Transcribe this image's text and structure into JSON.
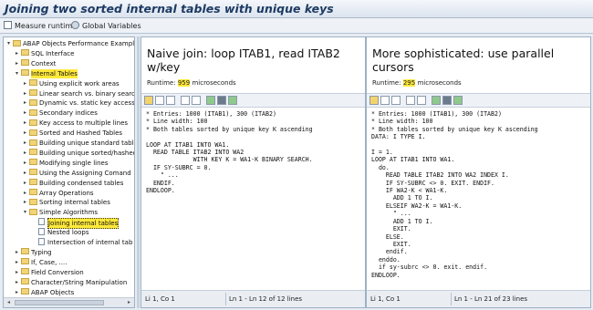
{
  "title": "Joining two sorted internal tables with unique keys",
  "toolbar": {
    "measure_label": "Measure runtime",
    "globals_label": "Global Variables"
  },
  "tree": {
    "items": [
      {
        "label": "ABAP Objects Performance Examples",
        "indent": 0,
        "type": "folder",
        "exp": "▾",
        "highlight": false
      },
      {
        "label": "SQL Interface",
        "indent": 1,
        "type": "folder",
        "exp": "▸",
        "highlight": false
      },
      {
        "label": "Context",
        "indent": 1,
        "type": "folder",
        "exp": "▸",
        "highlight": false
      },
      {
        "label": "Internal Tables",
        "indent": 1,
        "type": "folder",
        "exp": "▾",
        "highlight": true
      },
      {
        "label": "Using explicit work areas",
        "indent": 2,
        "type": "folder",
        "exp": "▸",
        "highlight": false
      },
      {
        "label": "Linear search vs. binary search",
        "indent": 2,
        "type": "folder",
        "exp": "▸",
        "highlight": false
      },
      {
        "label": "Dynamic vs. static key access",
        "indent": 2,
        "type": "folder",
        "exp": "▸",
        "highlight": false
      },
      {
        "label": "Secondary indices",
        "indent": 2,
        "type": "folder",
        "exp": "▸",
        "highlight": false
      },
      {
        "label": "Key access to multiple lines",
        "indent": 2,
        "type": "folder",
        "exp": "▸",
        "highlight": false
      },
      {
        "label": "Sorted and Hashed Tables",
        "indent": 2,
        "type": "folder",
        "exp": "▸",
        "highlight": false
      },
      {
        "label": "Building unique standard table",
        "indent": 2,
        "type": "folder",
        "exp": "▸",
        "highlight": false
      },
      {
        "label": "Building unique sorted/hashed",
        "indent": 2,
        "type": "folder",
        "exp": "▸",
        "highlight": false
      },
      {
        "label": "Modifying single lines",
        "indent": 2,
        "type": "folder",
        "exp": "▸",
        "highlight": false
      },
      {
        "label": "Using the Assigning Comand",
        "indent": 2,
        "type": "folder",
        "exp": "▸",
        "highlight": false
      },
      {
        "label": "Building condensed tables",
        "indent": 2,
        "type": "folder",
        "exp": "▸",
        "highlight": false
      },
      {
        "label": "Array Operations",
        "indent": 2,
        "type": "folder",
        "exp": "▸",
        "highlight": false
      },
      {
        "label": "Sorting internal tables",
        "indent": 2,
        "type": "folder",
        "exp": "▸",
        "highlight": false
      },
      {
        "label": "Simple Algorithms",
        "indent": 2,
        "type": "folder",
        "exp": "▾",
        "highlight": false
      },
      {
        "label": "Joining internal tables",
        "indent": 3,
        "type": "doc",
        "exp": "",
        "highlight": true
      },
      {
        "label": "Nested loops",
        "indent": 3,
        "type": "doc",
        "exp": "",
        "highlight": false
      },
      {
        "label": "Intersection of internal tab",
        "indent": 3,
        "type": "doc",
        "exp": "",
        "highlight": false
      },
      {
        "label": "Typing",
        "indent": 1,
        "type": "folder",
        "exp": "▸",
        "highlight": false
      },
      {
        "label": "If, Case, ....",
        "indent": 1,
        "type": "folder",
        "exp": "▸",
        "highlight": false
      },
      {
        "label": "Field Conversion",
        "indent": 1,
        "type": "folder",
        "exp": "▸",
        "highlight": false
      },
      {
        "label": "Character/String Manipulation",
        "indent": 1,
        "type": "folder",
        "exp": "▸",
        "highlight": false
      },
      {
        "label": "ABAP Objects",
        "indent": 1,
        "type": "folder",
        "exp": "▸",
        "highlight": false
      }
    ]
  },
  "left_panel": {
    "title": "Naive join: loop ITAB1, read ITAB2 w/key",
    "runtime_label": "Runtime:",
    "runtime_value": "959",
    "runtime_unit": "microseconds",
    "code": "* Entries: 1000 (ITAB1), 300 (ITAB2)\n* Line width: 100\n* Both tables sorted by unique key K ascending\n\nLOOP AT ITAB1 INTO WA1.\n  READ TABLE ITAB2 INTO WA2\n             WITH KEY K = WA1-K BINARY SEARCH.\n  IF SY-SUBRC = 0.\n    \" ...\n  ENDIF.\nENDLOOP.",
    "status_pos": "Li 1, Co 1",
    "status_lines": "Ln 1 - Ln 12 of 12 lines"
  },
  "right_panel": {
    "title": "More sophisticated: use parallel cursors",
    "runtime_label": "Runtime:",
    "runtime_value": "295",
    "runtime_unit": "microseconds",
    "code": "* Entries: 1000 (ITAB1), 300 (ITAB2)\n* Line width: 100\n* Both tables sorted by unique key K ascending\nDATA: I TYPE I.\n\nI = 1.\nLOOP AT ITAB1 INTO WA1.\n  do.\n    READ TABLE ITAB2 INTO WA2 INDEX I.\n    IF SY-SUBRC <> 0. EXIT. ENDIF.\n    IF WA2-K < WA1-K.\n      ADD 1 TO I.\n    ELSEIF WA2-K = WA1-K.\n      \" ...\n      ADD 1 TO I.\n      EXIT.\n    ELSE.\n      EXIT.\n    endif.\n  enddo.\n  if sy-subrc <> 0. exit. endif.\nENDLOOP.",
    "status_pos": "Li 1, Co 1",
    "status_lines": "Ln 1 - Ln 21 of 23 lines"
  },
  "colors": {
    "highlight": "#ffe93b",
    "folder": "#f0d477",
    "title_text": "#1d3a63"
  },
  "icons": [
    "measure-runtime-icon",
    "global-variables-icon",
    "folder-icon",
    "document-icon",
    "expand-icon"
  ]
}
